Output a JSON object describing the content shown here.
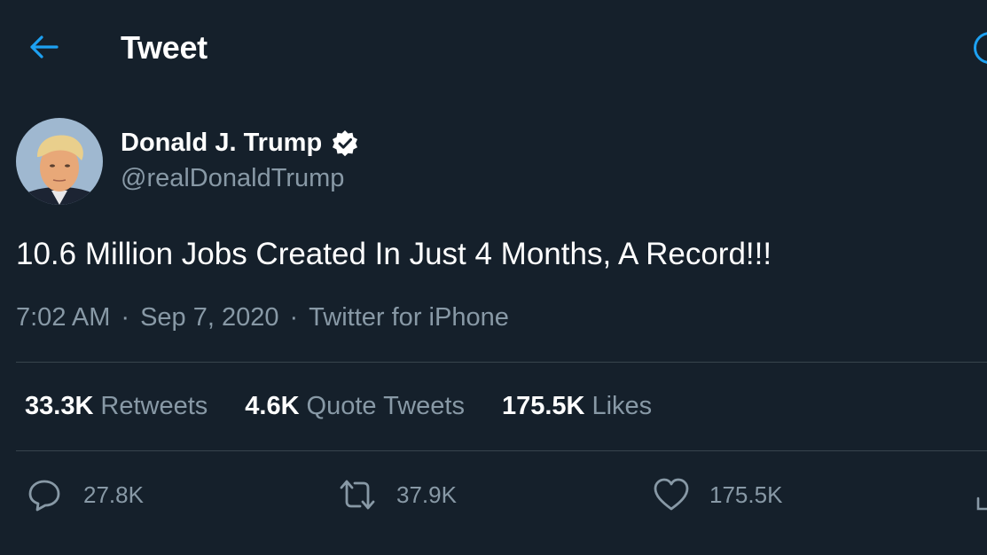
{
  "header": {
    "title": "Tweet",
    "back_icon": "arrow-left-icon"
  },
  "tweet": {
    "author": {
      "name": "Donald J. Trump",
      "handle": "@realDonaldTrump",
      "verified": true
    },
    "text": "10.6 Million Jobs Created In Just 4 Months, A Record!!!",
    "time": "7:02 AM",
    "date": "Sep 7, 2020",
    "separator": "·",
    "source": "Twitter for iPhone"
  },
  "stats": {
    "retweets": {
      "count": "33.3K",
      "label": "Retweets"
    },
    "quotes": {
      "count": "4.6K",
      "label": "Quote Tweets"
    },
    "likes": {
      "count": "175.5K",
      "label": "Likes"
    }
  },
  "actions": {
    "reply": {
      "icon": "reply-icon",
      "count": "27.8K"
    },
    "retweet": {
      "icon": "retweet-icon",
      "count": "37.9K"
    },
    "like": {
      "icon": "heart-icon",
      "count": "175.5K"
    },
    "share": {
      "icon": "share-icon"
    }
  },
  "colors": {
    "background": "#15202b",
    "accent": "#1da1f2",
    "secondary_text": "#8899a6",
    "divider": "#38444d"
  }
}
